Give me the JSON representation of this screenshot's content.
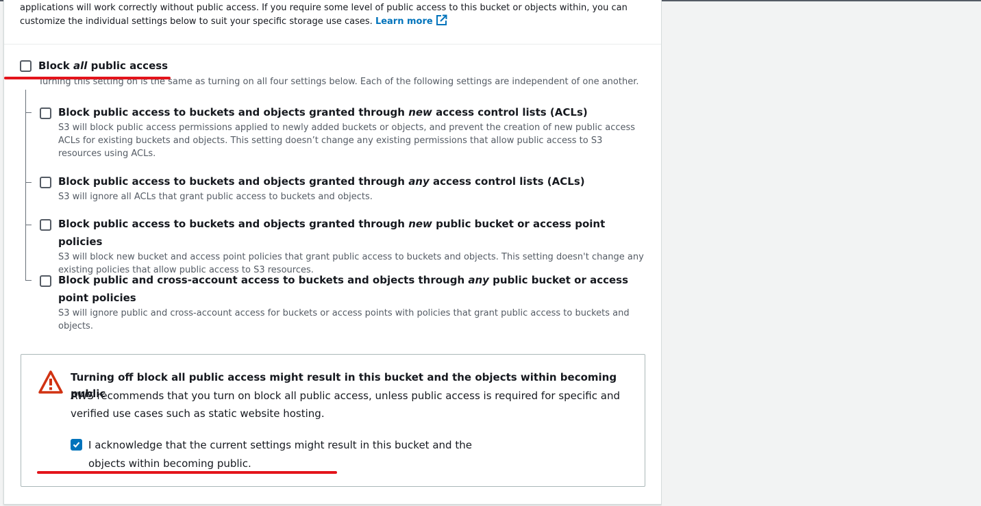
{
  "intro": {
    "text": "applications will work correctly without public access. If you require some level of public access to this bucket or objects within, you can customize the individual settings below to suit your specific storage use cases.",
    "learn_more": "Learn more"
  },
  "block_all": {
    "label_pre": "Block ",
    "label_em": "all",
    "label_post": " public access",
    "checked": false,
    "description": "Turning this setting on is the same as turning on all four settings below. Each of the following settings are independent of one another."
  },
  "options": [
    {
      "title_pre": "Block public access to buckets and objects granted through ",
      "title_em": "new",
      "title_post": " access control lists (ACLs)",
      "description": "S3 will block public access permissions applied to newly added buckets or objects, and prevent the creation of new public access ACLs for existing buckets and objects. This setting doesn’t change any existing permissions that allow public access to S3 resources using ACLs.",
      "checked": false
    },
    {
      "title_pre": "Block public access to buckets and objects granted through ",
      "title_em": "any",
      "title_post": " access control lists (ACLs)",
      "description": "S3 will ignore all ACLs that grant public access to buckets and objects.",
      "checked": false
    },
    {
      "title_pre": "Block public access to buckets and objects granted through ",
      "title_em": "new",
      "title_post": " public bucket or access point policies",
      "description": "S3 will block new bucket and access point policies that grant public access to buckets and objects. This setting doesn't change any existing policies that allow public access to S3 resources.",
      "checked": false
    },
    {
      "title_pre": "Block public and cross-account access to buckets and objects through ",
      "title_em": "any",
      "title_post": " public bucket or access point policies",
      "description": "S3 will ignore public and cross-account access for buckets or access points with policies that grant public access to buckets and objects.",
      "checked": false
    }
  ],
  "warning": {
    "icon": "warning-triangle-icon",
    "title": "Turning off block all public access might result in this bucket and the objects within becoming public",
    "body": "AWS recommends that you turn on block all public access, unless public access is required for specific and verified use cases such as static website hosting.",
    "acknowledge_line1": "I acknowledge that the current settings might result in this bucket and the",
    "acknowledge_line2": "objects within becoming public.",
    "acknowledge_checked": true
  },
  "colors": {
    "link": "#0073bb",
    "warning_red": "#d13212",
    "annotation_red": "#e3141b",
    "checkbox_checked": "#0073bb"
  }
}
